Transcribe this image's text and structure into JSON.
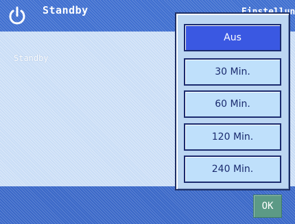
{
  "header": {
    "title": "Standby",
    "right_text": "Einstellungen",
    "icon": "power-icon"
  },
  "content": {
    "label": "Standby"
  },
  "popup": {
    "options": [
      {
        "label": "Aus",
        "selected": true
      },
      {
        "label": "30 Min.",
        "selected": false
      },
      {
        "label": "60 Min.",
        "selected": false
      },
      {
        "label": "120 Min.",
        "selected": false
      },
      {
        "label": "240 Min.",
        "selected": false
      }
    ]
  },
  "footer": {
    "ok_label": "OK"
  },
  "colors": {
    "titlebar": "#3f6fd0",
    "background": "#c9ddf6",
    "selected_option": "#3a58e2",
    "option": "#bfe0fb",
    "ok_button": "#5c9a86"
  }
}
